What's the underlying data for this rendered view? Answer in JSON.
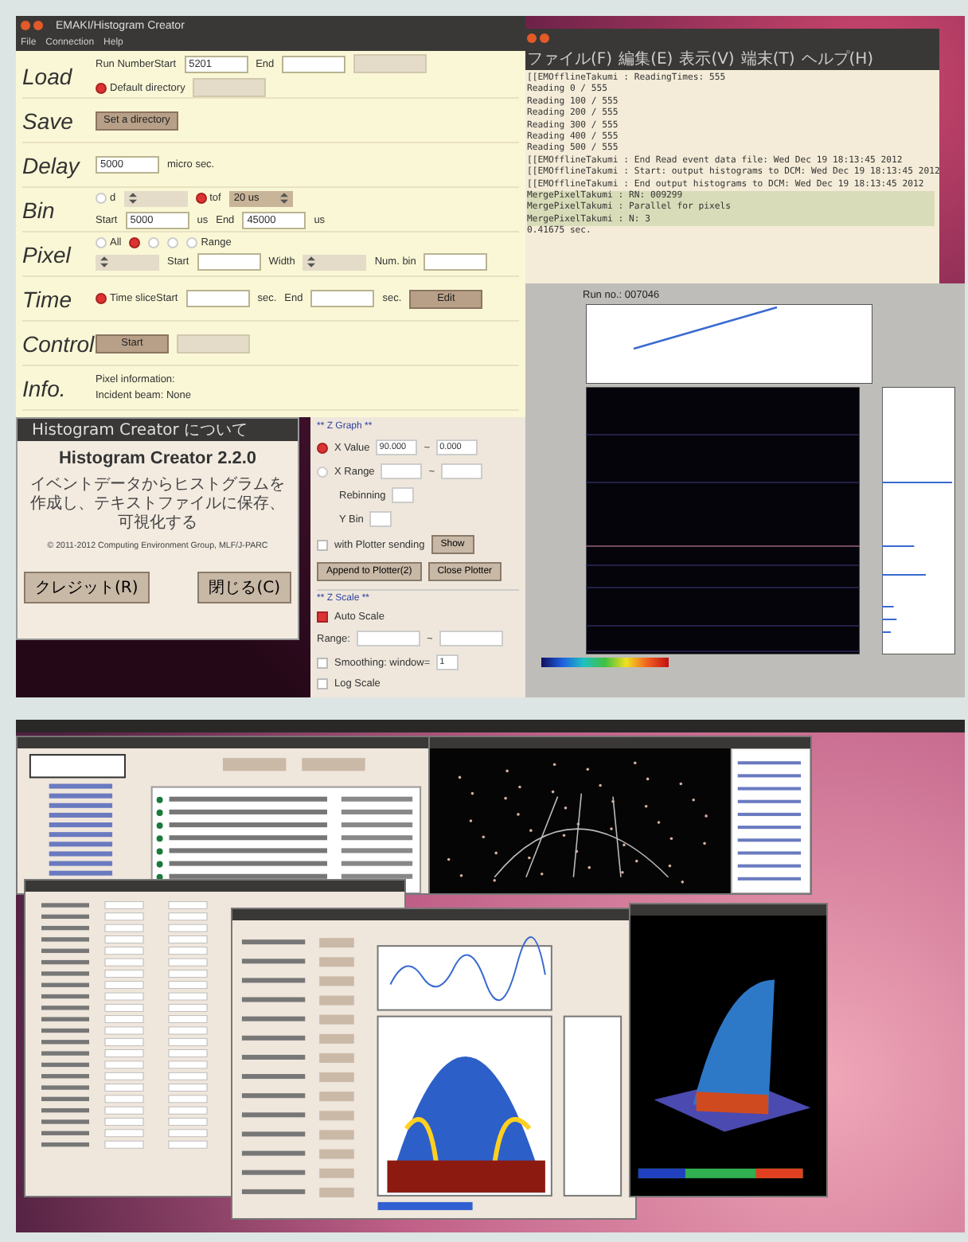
{
  "top_screen": {
    "main_window": {
      "title": "EMAKI/Histogram Creator",
      "menu": [
        "File",
        "Connection",
        "Help"
      ],
      "sections": [
        {
          "label": "Load",
          "rows": [
            [
              {
                "kind": "text",
                "text": "Run NumberStart"
              },
              {
                "kind": "field",
                "value": "5201"
              },
              {
                "kind": "text",
                "text": "End"
              },
              {
                "kind": "field"
              },
              {
                "kind": "button",
                "disabled": true
              }
            ],
            [
              {
                "kind": "radio",
                "text": "Default directory",
                "checked": true
              },
              {
                "kind": "button",
                "disabled": true
              }
            ]
          ]
        },
        {
          "label": "Save",
          "rows": [
            [
              {
                "kind": "button",
                "text": "Set a directory",
                "disabled": false
              }
            ]
          ]
        },
        {
          "label": "Delay",
          "rows": [
            [
              {
                "kind": "field",
                "value": "5000"
              },
              {
                "kind": "text",
                "text": "micro sec."
              }
            ]
          ]
        },
        {
          "label": "Bin",
          "rows": [
            [
              {
                "kind": "radio",
                "text": "d",
                "checked": false
              },
              {
                "kind": "select",
                "disabled": true
              },
              {
                "kind": "radio",
                "text": "tof",
                "checked": true
              },
              {
                "kind": "select",
                "value": "20 us",
                "disabled": false
              }
            ],
            [
              {
                "kind": "text",
                "text": "Start"
              },
              {
                "kind": "field",
                "value": "5000"
              },
              {
                "kind": "text",
                "text": "us"
              },
              {
                "kind": "text",
                "text": "End"
              },
              {
                "kind": "field",
                "value": "45000"
              },
              {
                "kind": "text",
                "text": "us"
              }
            ]
          ]
        },
        {
          "label": "Pixel",
          "rows": [
            [
              {
                "kind": "radio",
                "text": "All",
                "checked": false
              },
              {
                "kind": "radio",
                "checked": true
              },
              {
                "kind": "radio",
                "checked": false
              },
              {
                "kind": "radio",
                "checked": false
              },
              {
                "kind": "radio",
                "text": "Range",
                "checked": false
              }
            ],
            [
              {
                "kind": "select",
                "disabled": true
              },
              {
                "kind": "text",
                "text": "Start"
              },
              {
                "kind": "field"
              },
              {
                "kind": "text",
                "text": "Width"
              },
              {
                "kind": "select",
                "disabled": true
              },
              {
                "kind": "text",
                "text": "Num. bin"
              },
              {
                "kind": "field"
              }
            ]
          ]
        },
        {
          "label": "Time",
          "rows": [
            [
              {
                "kind": "radio",
                "text": "Time sliceStart",
                "checked": true
              },
              {
                "kind": "field"
              },
              {
                "kind": "text",
                "text": "sec."
              },
              {
                "kind": "text",
                "text": "End"
              },
              {
                "kind": "field"
              },
              {
                "kind": "text",
                "text": "sec."
              },
              {
                "kind": "button",
                "text": "Edit",
                "disabled": false
              }
            ]
          ]
        },
        {
          "label": "Control",
          "rows": [
            [
              {
                "kind": "button",
                "text": "Start",
                "disabled": false
              },
              {
                "kind": "button",
                "disabled": true
              }
            ]
          ]
        },
        {
          "label": "Info.",
          "rows": [
            [
              {
                "kind": "text",
                "text": "Pixel information:"
              }
            ],
            [
              {
                "kind": "text",
                "text": "Incident beam: None"
              }
            ]
          ]
        }
      ]
    },
    "terminal": {
      "menu": [
        "ファイル(F)",
        "編集(E)",
        "表示(V)",
        "端末(T)",
        "ヘルプ(H)"
      ],
      "lines": [
        {
          "text": "[[EMOfflineTakumi : ReadingTimes: 555",
          "highlighted": false
        },
        {
          "text": "Reading 0 / 555",
          "highlighted": false
        },
        {
          "text": "Reading 100 / 555",
          "highlighted": false
        },
        {
          "text": "Reading 200 / 555",
          "highlighted": false
        },
        {
          "text": "Reading 300 / 555",
          "highlighted": false
        },
        {
          "text": "Reading 400 / 555",
          "highlighted": false
        },
        {
          "text": "Reading 500 / 555",
          "highlighted": false
        },
        {
          "text": "[[EMOfflineTakumi : End Read event data file: Wed Dec 19 18:13:45 2012",
          "highlighted": false
        },
        {
          "text": "[[EMOfflineTakumi : Start: output histograms to DCM: Wed Dec 19 18:13:45 2012",
          "highlighted": false
        },
        {
          "text": "[[EMOfflineTakumi : End output histograms to DCM: Wed Dec 19 18:13:45 2012",
          "highlighted": false
        },
        {
          "text": "MergePixelTakumi : RN: 009299",
          "highlighted": true
        },
        {
          "text": "MergePixelTakumi : Parallel for pixels",
          "highlighted": true
        },
        {
          "text": "MergePixelTakumi : N: 3",
          "highlighted": true
        },
        {
          "text": "0.41675 sec.",
          "highlighted": false
        }
      ]
    },
    "about_dialog": {
      "title": "Histogram Creator について",
      "heading": "Histogram Creator 2.2.0",
      "description": "イベントデータからヒストグラムを作成し、テキストファイルに保存、可視化する",
      "copyright": "© 2011-2012 Computing Environment Group, MLF/J-PARC",
      "buttons": [
        "クレジット(R)",
        "閉じる(C)"
      ]
    },
    "z_graph_panel": {
      "heading": "** Z Graph **",
      "options": [
        {
          "text": "X Value",
          "checked": true,
          "from": "90.000",
          "separator": "~",
          "to": "0.000"
        },
        {
          "text": "X Range",
          "checked": false,
          "separator": "~"
        }
      ],
      "rebinning_labels": [
        "Rebinning",
        "Y Bin"
      ],
      "plotter_check": {
        "text": "with Plotter sending",
        "checked": false
      },
      "buttons": [
        "Show",
        "Append to Plotter(2)",
        "Close Plotter"
      ],
      "scale_heading": "** Z Scale **",
      "auto_scale": {
        "text": "Auto Scale",
        "checked": true
      },
      "range_label": "Range:",
      "range_separator": "~",
      "smoothing": {
        "text": "Smoothing: window=",
        "value": "1",
        "checked": false
      },
      "log_scale": {
        "text": "Log Scale",
        "checked": false
      }
    },
    "plot_window": {
      "run_label": "Run no.: 007046"
    }
  },
  "bottom_screen": {
    "windows": [
      {
        "kind": "database"
      },
      {
        "kind": "points3d"
      },
      {
        "kind": "settings"
      },
      {
        "kind": "plotter"
      },
      {
        "kind": "surface3d"
      }
    ]
  }
}
